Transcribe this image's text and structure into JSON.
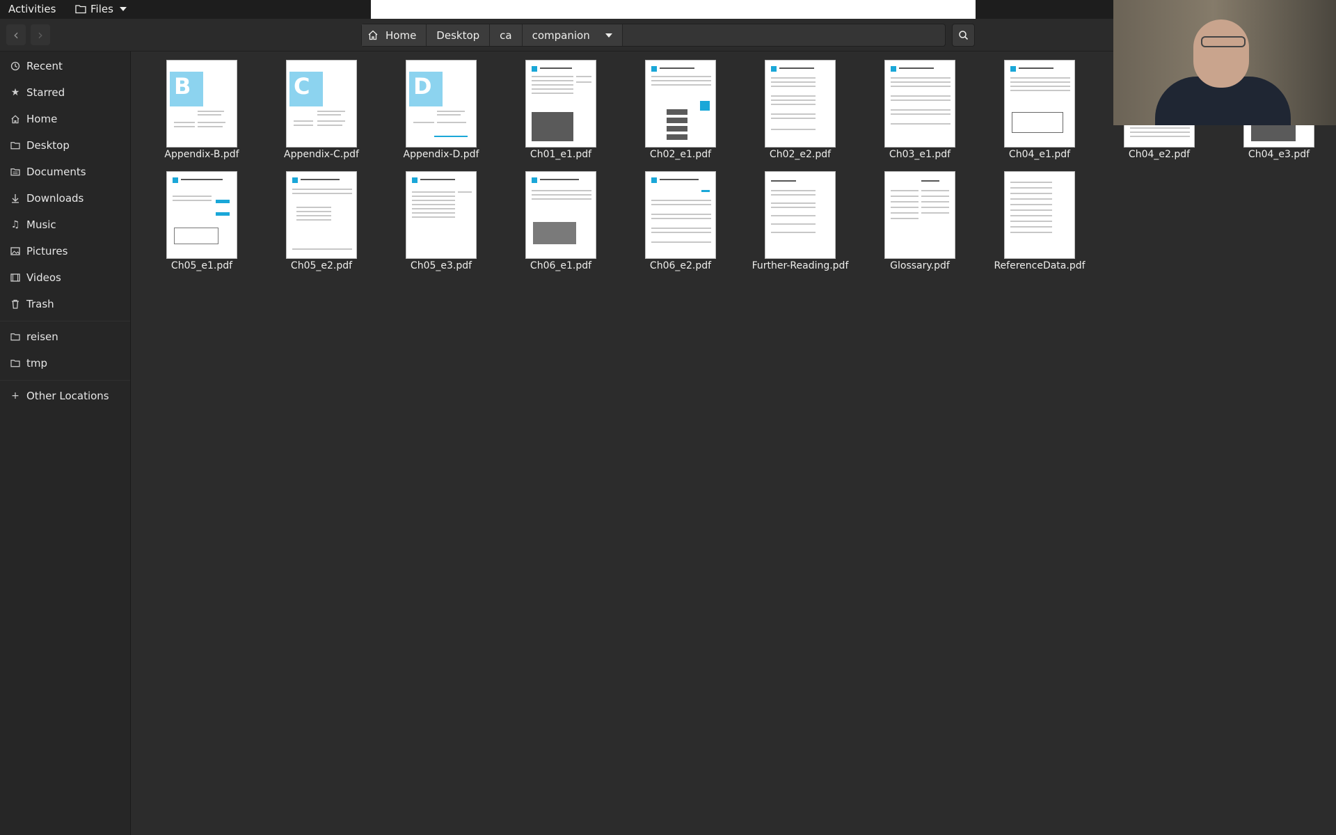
{
  "topbar": {
    "activities": "Activities",
    "app_menu": "Files"
  },
  "header": {
    "back_icon": "chevron-left-icon",
    "forward_icon": "chevron-right-icon",
    "path": [
      {
        "label": "Home",
        "icon": "home-icon"
      },
      {
        "label": "Desktop"
      },
      {
        "label": "ca"
      },
      {
        "label": "companion"
      }
    ],
    "search_icon": "search-icon"
  },
  "sidebar": {
    "items": [
      {
        "label": "Recent",
        "icon": "clock-icon"
      },
      {
        "label": "Starred",
        "icon": "star-icon"
      },
      {
        "label": "Home",
        "icon": "home-icon"
      },
      {
        "label": "Desktop",
        "icon": "folder-icon"
      },
      {
        "label": "Documents",
        "icon": "document-icon"
      },
      {
        "label": "Downloads",
        "icon": "download-icon"
      },
      {
        "label": "Music",
        "icon": "music-icon"
      },
      {
        "label": "Pictures",
        "icon": "picture-icon"
      },
      {
        "label": "Videos",
        "icon": "video-icon"
      },
      {
        "label": "Trash",
        "icon": "trash-icon"
      }
    ],
    "bookmarks": [
      {
        "label": "reisen",
        "icon": "folder-icon"
      },
      {
        "label": "tmp",
        "icon": "folder-icon"
      }
    ],
    "other": {
      "label": "Other Locations",
      "icon": "plus-icon"
    }
  },
  "files": [
    {
      "name": "Appendix-B.pdf",
      "cover_letter": "B"
    },
    {
      "name": "Appendix-C.pdf",
      "cover_letter": "C"
    },
    {
      "name": "Appendix-D.pdf",
      "cover_letter": "D"
    },
    {
      "name": "Ch01_e1.pdf"
    },
    {
      "name": "Ch02_e1.pdf"
    },
    {
      "name": "Ch02_e2.pdf"
    },
    {
      "name": "Ch03_e1.pdf"
    },
    {
      "name": "Ch04_e1.pdf"
    },
    {
      "name": "Ch04_e2.pdf"
    },
    {
      "name": "Ch04_e3.pdf"
    },
    {
      "name": "Ch05_e1.pdf"
    },
    {
      "name": "Ch05_e2.pdf"
    },
    {
      "name": "Ch05_e3.pdf"
    },
    {
      "name": "Ch06_e1.pdf"
    },
    {
      "name": "Ch06_e2.pdf"
    },
    {
      "name": "Further-Reading.pdf"
    },
    {
      "name": "Glossary.pdf"
    },
    {
      "name": "ReferenceData.pdf"
    }
  ]
}
